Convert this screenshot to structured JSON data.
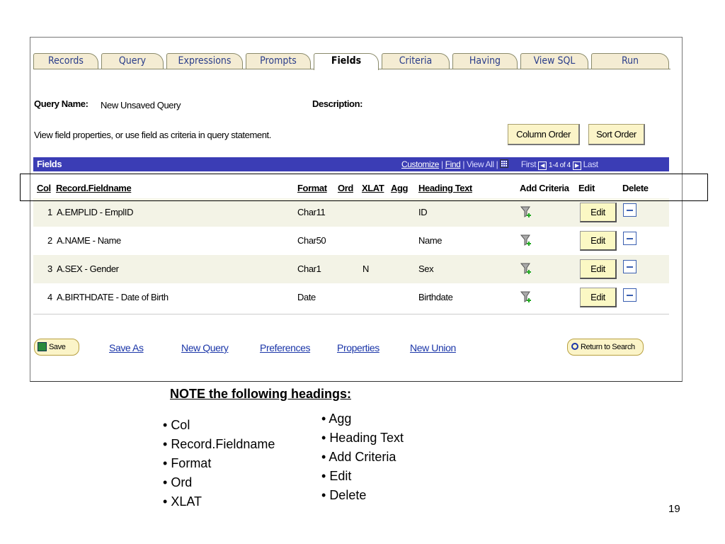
{
  "tabs": [
    "Records",
    "Query",
    "Expressions",
    "Prompts",
    "Fields",
    "Criteria",
    "Having",
    "View SQL",
    "Run"
  ],
  "active_tab": "Fields",
  "query_name_label": "Query Name:",
  "query_name_value": "New Unsaved Query",
  "description_label": "Description:",
  "instruction": "View field properties, or use field as criteria in query statement.",
  "column_order_button": "Column Order",
  "sort_order_button": "Sort Order",
  "grid": {
    "title": "Fields",
    "customize": "Customize",
    "find": "Find",
    "view_all": "View All",
    "first": "First",
    "range": "1-4 of 4",
    "last": "Last",
    "columns": {
      "col": "Col",
      "fieldname": "Record.Fieldname",
      "format": "Format",
      "ord": "Ord",
      "xlat": "XLAT",
      "agg": "Agg",
      "heading": "Heading Text",
      "add_criteria": "Add Criteria",
      "edit": "Edit",
      "delete": "Delete"
    },
    "rows": [
      {
        "col": "1",
        "field": "A.EMPLID - EmplID",
        "format": "Char11",
        "ord": "",
        "xlat": "",
        "agg": "",
        "heading": "ID",
        "edit": "Edit"
      },
      {
        "col": "2",
        "field": "A.NAME - Name",
        "format": "Char50",
        "ord": "",
        "xlat": "",
        "agg": "",
        "heading": "Name",
        "edit": "Edit"
      },
      {
        "col": "3",
        "field": "A.SEX - Gender",
        "format": "Char1",
        "ord": "",
        "xlat": "N",
        "agg": "",
        "heading": "Sex",
        "edit": "Edit"
      },
      {
        "col": "4",
        "field": "A.BIRTHDATE - Date of Birth",
        "format": "Date",
        "ord": "",
        "xlat": "",
        "agg": "",
        "heading": "Birthdate",
        "edit": "Edit"
      }
    ]
  },
  "footer": {
    "save": "Save",
    "save_as": "Save As",
    "new_query": "New Query",
    "preferences": "Preferences",
    "properties": "Properties",
    "new_union": "New Union",
    "return_to_search": "Return to Search"
  },
  "note_title": "NOTE the following headings:",
  "bullets_left": [
    "Col",
    "Record.Fieldname",
    "Format",
    "Ord",
    "XLAT"
  ],
  "bullets_right": [
    "Agg",
    "Heading Text",
    "Add Criteria",
    "Edit",
    "Delete"
  ],
  "page_number": "19"
}
